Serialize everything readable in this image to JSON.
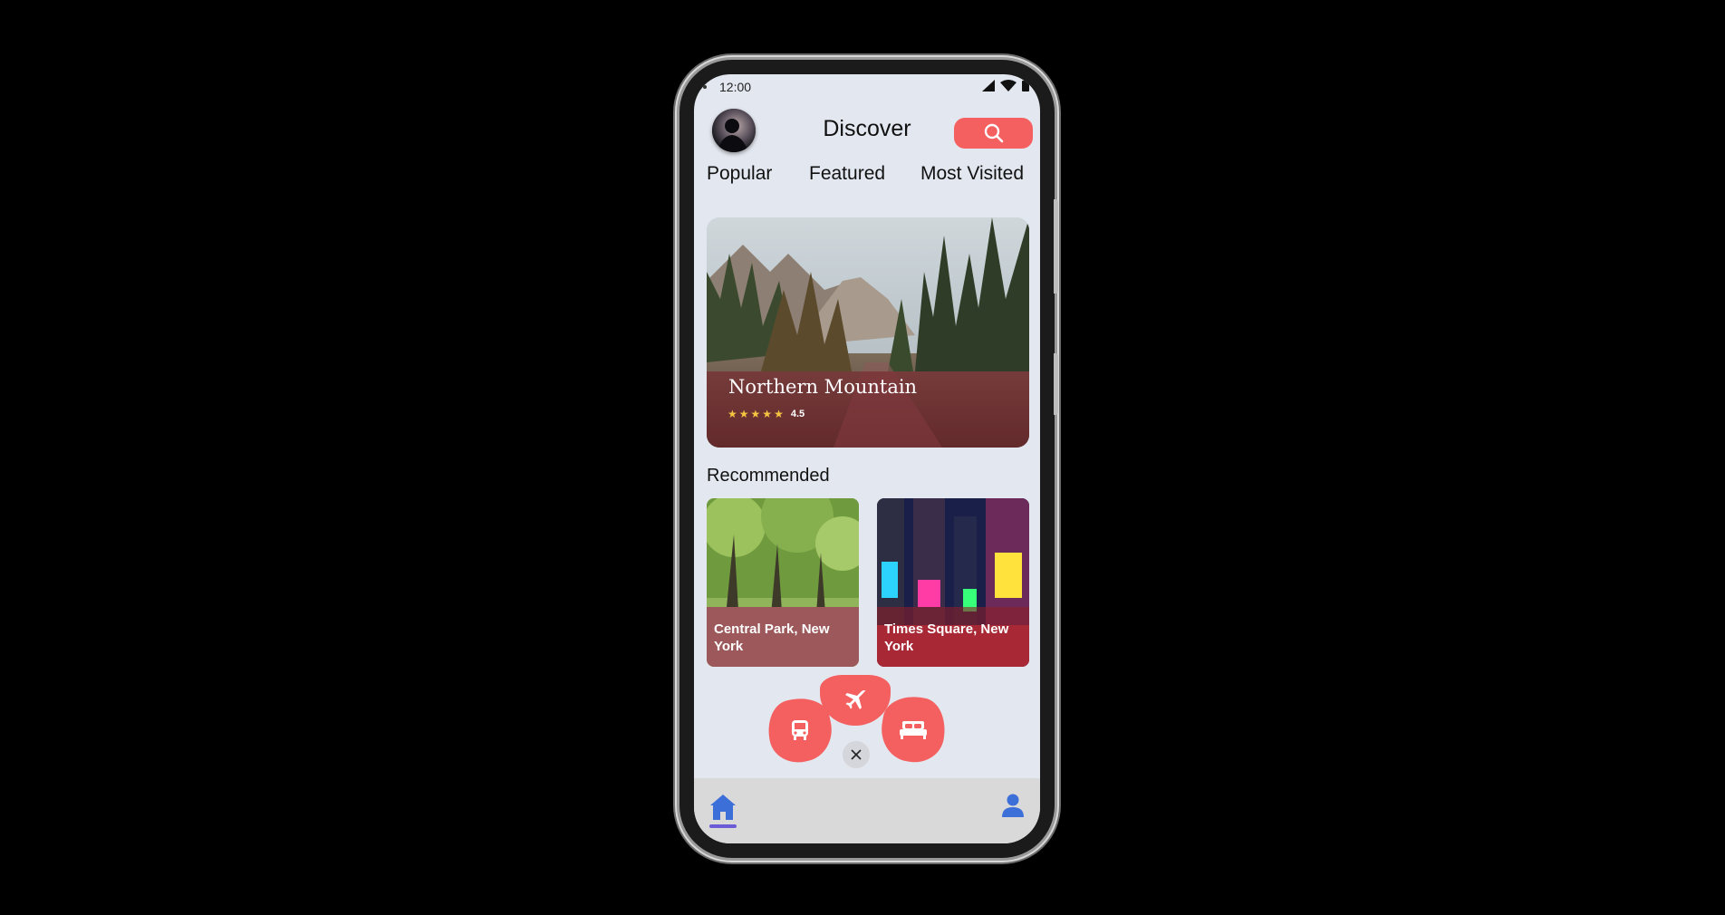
{
  "status_bar": {
    "time": "12:00"
  },
  "header": {
    "title": "Discover"
  },
  "tabs": [
    {
      "label": "Popular"
    },
    {
      "label": "Featured"
    },
    {
      "label": "Most Visited"
    }
  ],
  "hero": {
    "title": "Northern Mountain",
    "rating": "4.5",
    "stars": 5
  },
  "recommended": {
    "title": "Recommended",
    "items": [
      {
        "label": "Central Park, New York"
      },
      {
        "label": "Times Square, New York"
      }
    ]
  },
  "fab_menu": {
    "icons": [
      "bus-icon",
      "airplane-icon",
      "bed-icon",
      "close-icon"
    ]
  },
  "bottom_nav": {
    "items": [
      "home-icon",
      "user-icon"
    ],
    "active": "home"
  },
  "colors": {
    "accent": "#f4605f",
    "nav_active": "#3d6fd9",
    "background": "#e3e7ef"
  }
}
